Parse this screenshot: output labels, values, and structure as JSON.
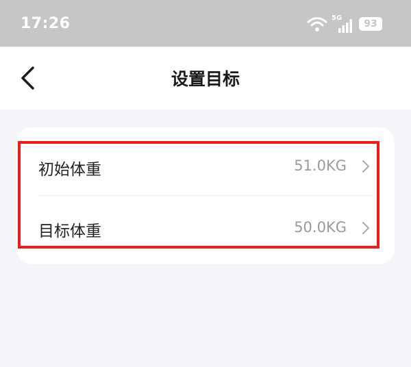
{
  "status_bar": {
    "time": "17:26",
    "network": "5G",
    "battery": "93",
    "icons": [
      "wifi-icon",
      "signal-icon",
      "battery-icon"
    ]
  },
  "nav": {
    "title": "设置目标",
    "back_icon": "chevron-left-icon"
  },
  "settings": {
    "items": [
      {
        "label": "初始体重",
        "value": "51.0KG",
        "icon": "chevron-right-icon"
      },
      {
        "label": "目标体重",
        "value": "50.0KG",
        "icon": "chevron-right-icon"
      }
    ]
  },
  "colors": {
    "status_bar_bg": "#c6c6c6",
    "page_bg": "#f4f5f9",
    "highlight": "#ee1c1c",
    "value_text": "#9a9a9a"
  }
}
